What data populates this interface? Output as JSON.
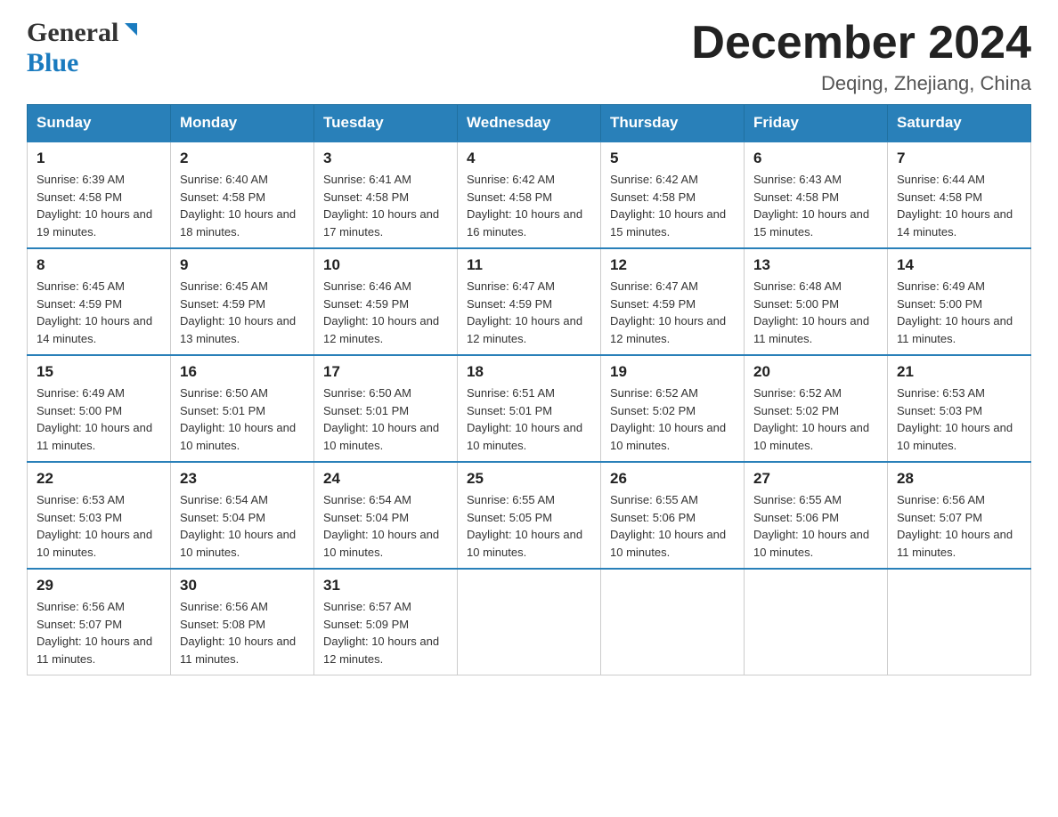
{
  "logo": {
    "general": "General",
    "blue": "Blue"
  },
  "header": {
    "month": "December 2024",
    "location": "Deqing, Zhejiang, China"
  },
  "weekdays": [
    "Sunday",
    "Monday",
    "Tuesday",
    "Wednesday",
    "Thursday",
    "Friday",
    "Saturday"
  ],
  "weeks": [
    [
      {
        "day": "1",
        "sunrise": "6:39 AM",
        "sunset": "4:58 PM",
        "daylight": "10 hours and 19 minutes."
      },
      {
        "day": "2",
        "sunrise": "6:40 AM",
        "sunset": "4:58 PM",
        "daylight": "10 hours and 18 minutes."
      },
      {
        "day": "3",
        "sunrise": "6:41 AM",
        "sunset": "4:58 PM",
        "daylight": "10 hours and 17 minutes."
      },
      {
        "day": "4",
        "sunrise": "6:42 AM",
        "sunset": "4:58 PM",
        "daylight": "10 hours and 16 minutes."
      },
      {
        "day": "5",
        "sunrise": "6:42 AM",
        "sunset": "4:58 PM",
        "daylight": "10 hours and 15 minutes."
      },
      {
        "day": "6",
        "sunrise": "6:43 AM",
        "sunset": "4:58 PM",
        "daylight": "10 hours and 15 minutes."
      },
      {
        "day": "7",
        "sunrise": "6:44 AM",
        "sunset": "4:58 PM",
        "daylight": "10 hours and 14 minutes."
      }
    ],
    [
      {
        "day": "8",
        "sunrise": "6:45 AM",
        "sunset": "4:59 PM",
        "daylight": "10 hours and 14 minutes."
      },
      {
        "day": "9",
        "sunrise": "6:45 AM",
        "sunset": "4:59 PM",
        "daylight": "10 hours and 13 minutes."
      },
      {
        "day": "10",
        "sunrise": "6:46 AM",
        "sunset": "4:59 PM",
        "daylight": "10 hours and 12 minutes."
      },
      {
        "day": "11",
        "sunrise": "6:47 AM",
        "sunset": "4:59 PM",
        "daylight": "10 hours and 12 minutes."
      },
      {
        "day": "12",
        "sunrise": "6:47 AM",
        "sunset": "4:59 PM",
        "daylight": "10 hours and 12 minutes."
      },
      {
        "day": "13",
        "sunrise": "6:48 AM",
        "sunset": "5:00 PM",
        "daylight": "10 hours and 11 minutes."
      },
      {
        "day": "14",
        "sunrise": "6:49 AM",
        "sunset": "5:00 PM",
        "daylight": "10 hours and 11 minutes."
      }
    ],
    [
      {
        "day": "15",
        "sunrise": "6:49 AM",
        "sunset": "5:00 PM",
        "daylight": "10 hours and 11 minutes."
      },
      {
        "day": "16",
        "sunrise": "6:50 AM",
        "sunset": "5:01 PM",
        "daylight": "10 hours and 10 minutes."
      },
      {
        "day": "17",
        "sunrise": "6:50 AM",
        "sunset": "5:01 PM",
        "daylight": "10 hours and 10 minutes."
      },
      {
        "day": "18",
        "sunrise": "6:51 AM",
        "sunset": "5:01 PM",
        "daylight": "10 hours and 10 minutes."
      },
      {
        "day": "19",
        "sunrise": "6:52 AM",
        "sunset": "5:02 PM",
        "daylight": "10 hours and 10 minutes."
      },
      {
        "day": "20",
        "sunrise": "6:52 AM",
        "sunset": "5:02 PM",
        "daylight": "10 hours and 10 minutes."
      },
      {
        "day": "21",
        "sunrise": "6:53 AM",
        "sunset": "5:03 PM",
        "daylight": "10 hours and 10 minutes."
      }
    ],
    [
      {
        "day": "22",
        "sunrise": "6:53 AM",
        "sunset": "5:03 PM",
        "daylight": "10 hours and 10 minutes."
      },
      {
        "day": "23",
        "sunrise": "6:54 AM",
        "sunset": "5:04 PM",
        "daylight": "10 hours and 10 minutes."
      },
      {
        "day": "24",
        "sunrise": "6:54 AM",
        "sunset": "5:04 PM",
        "daylight": "10 hours and 10 minutes."
      },
      {
        "day": "25",
        "sunrise": "6:55 AM",
        "sunset": "5:05 PM",
        "daylight": "10 hours and 10 minutes."
      },
      {
        "day": "26",
        "sunrise": "6:55 AM",
        "sunset": "5:06 PM",
        "daylight": "10 hours and 10 minutes."
      },
      {
        "day": "27",
        "sunrise": "6:55 AM",
        "sunset": "5:06 PM",
        "daylight": "10 hours and 10 minutes."
      },
      {
        "day": "28",
        "sunrise": "6:56 AM",
        "sunset": "5:07 PM",
        "daylight": "10 hours and 11 minutes."
      }
    ],
    [
      {
        "day": "29",
        "sunrise": "6:56 AM",
        "sunset": "5:07 PM",
        "daylight": "10 hours and 11 minutes."
      },
      {
        "day": "30",
        "sunrise": "6:56 AM",
        "sunset": "5:08 PM",
        "daylight": "10 hours and 11 minutes."
      },
      {
        "day": "31",
        "sunrise": "6:57 AM",
        "sunset": "5:09 PM",
        "daylight": "10 hours and 12 minutes."
      },
      null,
      null,
      null,
      null
    ]
  ]
}
